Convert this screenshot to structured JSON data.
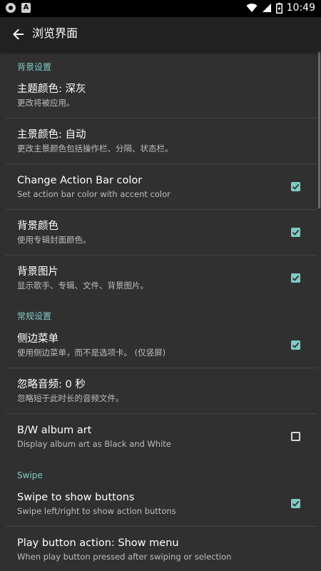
{
  "status_bar": {
    "time": "10:49",
    "left_icons": [
      "app-notification-icon",
      "a-notification-icon"
    ],
    "right_icons": [
      "wifi-icon",
      "signal-icon",
      "battery-icon"
    ]
  },
  "app_bar": {
    "title": "浏览界面",
    "back_icon": "arrow-back-icon"
  },
  "colors": {
    "background": "#303030",
    "app_bar": "#212121",
    "accent": "#80cbc4",
    "status_bar": "#000000",
    "divider": "#444444"
  },
  "sections": [
    {
      "header": "背景设置",
      "items": [
        {
          "title": "主题颜色: 深灰",
          "summary": "更改将被应用。",
          "checkbox": null
        },
        {
          "title": "主景颜色: 自动",
          "summary": "更改主景颜色包括操作栏、分隔、状态栏。",
          "checkbox": null
        },
        {
          "title": "Change Action Bar color",
          "summary": "Set action bar color with accent color",
          "checkbox": true
        },
        {
          "title": "背景颜色",
          "summary": "使用专辑封面颜色。",
          "checkbox": true
        },
        {
          "title": "背景图片",
          "summary": "显示歌手、专辑、文件、背景图片。",
          "checkbox": true
        }
      ]
    },
    {
      "header": "常规设置",
      "items": [
        {
          "title": "侧边菜单",
          "summary": "使用侧边菜单，而不是选项卡。 (仅竖屏)",
          "checkbox": true
        },
        {
          "title": "忽略音频: 0 秒",
          "summary": "忽略短于此时长的音频文件。",
          "checkbox": null
        },
        {
          "title": "B/W album art",
          "summary": "Display album art as Black and White",
          "checkbox": false
        }
      ]
    },
    {
      "header": "Swipe",
      "items": [
        {
          "title": "Swipe to show buttons",
          "summary": "Swipe left/right to show action buttons",
          "checkbox": true
        },
        {
          "title": "Play button action: Show menu",
          "summary": "When play button pressed after swiping or selection",
          "checkbox": null
        }
      ]
    }
  ]
}
